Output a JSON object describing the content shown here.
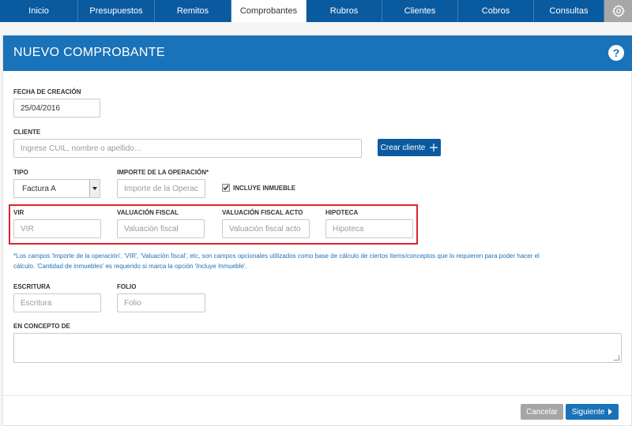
{
  "nav": {
    "tabs": [
      {
        "label": "Inicio",
        "active": false
      },
      {
        "label": "Presupuestos",
        "active": false
      },
      {
        "label": "Remitos",
        "active": false
      },
      {
        "label": "Comprobantes",
        "active": true
      },
      {
        "label": "Rubros",
        "active": false
      },
      {
        "label": "Clientes",
        "active": false
      },
      {
        "label": "Cobros",
        "active": false
      },
      {
        "label": "Consultas",
        "active": false
      }
    ],
    "settings_icon": "gear-icon"
  },
  "panel": {
    "title": "NUEVO COMPROBANTE",
    "help_label": "?"
  },
  "form": {
    "fecha": {
      "label": "FECHA DE CREACIÓN",
      "value": "25/04/2016"
    },
    "cliente": {
      "label": "CLIENTE",
      "placeholder": "Ingrese CUIL, nombre o apellido..."
    },
    "crear_cliente": {
      "label": "Crear cliente",
      "icon": "plus-icon"
    },
    "tipo": {
      "label": "TIPO",
      "value": "Factura A"
    },
    "importe": {
      "label": "IMPORTE DE LA OPERACIÓN*",
      "placeholder": "Importe de la Operación"
    },
    "incluye_inmueble": {
      "label": "INCLUYE INMUEBLE",
      "checked": true
    },
    "vir": {
      "label": "VIR",
      "placeholder": "VIR"
    },
    "valuacion_fiscal": {
      "label": "VALUACIÓN FISCAL",
      "placeholder": "Valuación fiscal"
    },
    "valuacion_fiscal_acto": {
      "label": "VALUACIÓN FISCAL ACTO",
      "placeholder": "Valuación fiscal acto"
    },
    "hipoteca": {
      "label": "HIPOTECA",
      "placeholder": "Hipoteca"
    },
    "note_line1": "*Los campos 'Importe de la operación', 'VIR', 'Valuación fiscal', etc, son campos opcionales utilizados como base de cálculo de ciertos items/conceptos que lo requieren para poder hacer el",
    "note_line2": "cálculo. 'Cantidad de inmuebles' es requerido si marca la opción 'Incluye Inmueble'.",
    "escritura": {
      "label": "ESCRITURA",
      "placeholder": "Escritura"
    },
    "folio": {
      "label": "FOLIO",
      "placeholder": "Folio"
    },
    "concepto": {
      "label": "EN CONCEPTO DE"
    }
  },
  "footer": {
    "cancel_label": "Cancelar",
    "next_label": "Siguiente"
  },
  "colors": {
    "nav_bg": "#0a5aa0",
    "header_bg": "#1a72b8",
    "highlight": "#d9262b",
    "note_text": "#1a72b8"
  }
}
